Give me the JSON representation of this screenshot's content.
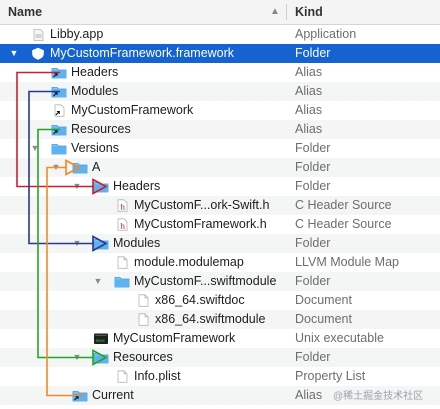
{
  "header": {
    "name": "Name",
    "kind": "Kind"
  },
  "rows": [
    {
      "id": "libby-app",
      "chevron": "",
      "icon": "app-icon",
      "name": "Libby.app",
      "kind": "Application"
    },
    {
      "id": "mycustomframework-framework",
      "chevron": "down",
      "icon": "framework-icon",
      "name": "MyCustomFramework.framework",
      "kind": "Folder",
      "selected": true
    },
    {
      "id": "headers-alias",
      "chevron": "",
      "icon": "folder-alias-icon",
      "name": "Headers",
      "kind": "Alias"
    },
    {
      "id": "modules-alias",
      "chevron": "",
      "icon": "folder-alias-icon",
      "name": "Modules",
      "kind": "Alias"
    },
    {
      "id": "mycustomframework-alias",
      "chevron": "",
      "icon": "file-alias-icon",
      "name": "MyCustomFramework",
      "kind": "Alias"
    },
    {
      "id": "resources-alias",
      "chevron": "",
      "icon": "folder-alias-icon",
      "name": "Resources",
      "kind": "Alias"
    },
    {
      "id": "versions-folder",
      "chevron": "down",
      "icon": "folder-icon",
      "name": "Versions",
      "kind": "Folder"
    },
    {
      "id": "a-folder",
      "chevron": "down",
      "icon": "folder-icon",
      "name": "A",
      "kind": "Folder"
    },
    {
      "id": "headers-folder",
      "chevron": "down",
      "icon": "folder-icon",
      "name": "Headers",
      "kind": "Folder"
    },
    {
      "id": "swift-header",
      "chevron": "",
      "icon": "header-file-icon",
      "name": "MyCustomF...ork-Swift.h",
      "kind": "C Header Source"
    },
    {
      "id": "framework-header",
      "chevron": "",
      "icon": "header-file-icon",
      "name": "MyCustomFramework.h",
      "kind": "C Header Source"
    },
    {
      "id": "modules-folder",
      "chevron": "down",
      "icon": "folder-icon",
      "name": "Modules",
      "kind": "Folder"
    },
    {
      "id": "modulemap-file",
      "chevron": "",
      "icon": "document-icon",
      "name": "module.modulemap",
      "kind": "LLVM Module Map"
    },
    {
      "id": "swiftmodule-folder",
      "chevron": "down",
      "icon": "folder-icon",
      "name": "MyCustomF...swiftmodule",
      "kind": "Folder"
    },
    {
      "id": "swiftdoc-file",
      "chevron": "",
      "icon": "document-icon",
      "name": "x86_64.swiftdoc",
      "kind": "Document"
    },
    {
      "id": "x86-swiftmodule-file",
      "chevron": "",
      "icon": "document-icon",
      "name": "x86_64.swiftmodule",
      "kind": "Document"
    },
    {
      "id": "unix-executable",
      "chevron": "",
      "icon": "exec-icon",
      "name": "MyCustomFramework",
      "kind": "Unix executable"
    },
    {
      "id": "resources-folder",
      "chevron": "down",
      "icon": "folder-icon",
      "name": "Resources",
      "kind": "Folder"
    },
    {
      "id": "info-plist",
      "chevron": "",
      "icon": "document-icon",
      "name": "Info.plist",
      "kind": "Property List"
    },
    {
      "id": "current-alias",
      "chevron": "",
      "icon": "folder-alias-icon",
      "name": "Current",
      "kind": "Alias"
    }
  ],
  "colors": {
    "selection": "#1463d1",
    "arrow_headers": "#cc1f2e",
    "arrow_modules": "#2a3790",
    "arrow_resources": "#27a32a",
    "arrow_current": "#f08a24"
  },
  "watermark": "@稀土掘金技术社区"
}
